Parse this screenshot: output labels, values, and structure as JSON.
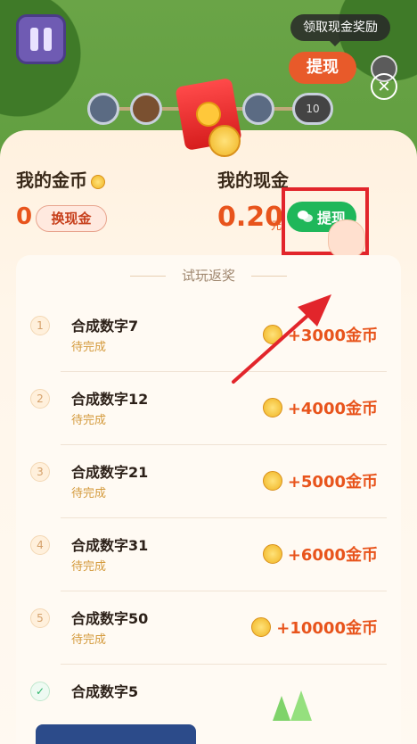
{
  "header": {
    "tooltip": "领取现金奖励",
    "withdraw_label": "提现"
  },
  "coin_track": {
    "node_label": "10"
  },
  "wallet": {
    "coins_title": "我的金币",
    "coins_value": "0",
    "exchange_label": "换现金",
    "cash_title": "我的现金",
    "cash_value": "0.20",
    "cash_unit": "元",
    "withdraw_label": "提现"
  },
  "rewards": {
    "section_title": "试玩返奖",
    "items": [
      {
        "index": "1",
        "title": "合成数字7",
        "status": "待完成",
        "reward": "+3000金币"
      },
      {
        "index": "2",
        "title": "合成数字12",
        "status": "待完成",
        "reward": "+4000金币"
      },
      {
        "index": "3",
        "title": "合成数字21",
        "status": "待完成",
        "reward": "+5000金币"
      },
      {
        "index": "4",
        "title": "合成数字31",
        "status": "待完成",
        "reward": "+6000金币"
      },
      {
        "index": "5",
        "title": "合成数字50",
        "status": "待完成",
        "reward": "+10000金币"
      },
      {
        "index": "✓",
        "title": "合成数字5",
        "status": "",
        "reward": ""
      }
    ]
  },
  "colors": {
    "accent_orange": "#e8541c",
    "wechat_green": "#1fb75a",
    "highlight_red": "#e2252b"
  },
  "icons": [
    "pause-icon",
    "settings-icon",
    "close-icon",
    "gold-coin-icon",
    "wechat-icon",
    "hand-pointer-icon",
    "red-packet-icon",
    "arrow-icon"
  ]
}
